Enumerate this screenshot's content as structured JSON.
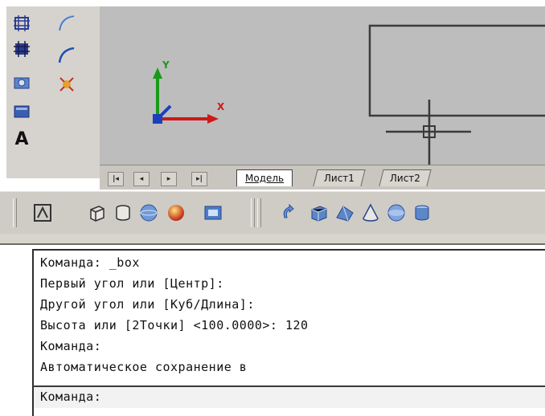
{
  "left_palette": {
    "icons": [
      "rectangle-select-icon",
      "rectangle-fill-icon",
      "camera-icon",
      "table-icon",
      "text-icon"
    ],
    "text_tool_label": "A"
  },
  "mid_palette": {
    "icons": [
      "arc-icon",
      "arc-blue-icon",
      "explode-icon"
    ]
  },
  "viewport": {
    "ucs_y_label": "Y",
    "ucs_x_label": "X"
  },
  "tabs": {
    "nav": [
      "first-icon",
      "prev-icon",
      "next-icon",
      "last-icon"
    ],
    "items": [
      "Модель",
      "Лист1",
      "Лист2"
    ],
    "active": "Модель"
  },
  "toolbar3d": {
    "icons": [
      "render-icon",
      "box-icon",
      "cylinder-icon",
      "sphere-icon",
      "material-icon",
      "camera-view-icon",
      "rotate-icon",
      "box-solid-icon",
      "wedge-icon",
      "cone-icon",
      "sphere-solid-icon",
      "cylinder-solid-icon"
    ]
  },
  "command_window": {
    "lines": [
      "Команда: _box",
      "Первый угол или [Центр]:",
      "Другой угол или [Куб/Длина]:",
      "Высота или [2Точки] <100.0000>: 120",
      "Команда:",
      "Автоматическое сохранение в"
    ],
    "prompt": "Команда:"
  },
  "colors": {
    "viewport_bg": "#bdbdbd",
    "axis_y": "#1a9a1a",
    "axis_x": "#d01818",
    "axis_z": "#1a3fbf",
    "panel": "#d6d3ce"
  }
}
